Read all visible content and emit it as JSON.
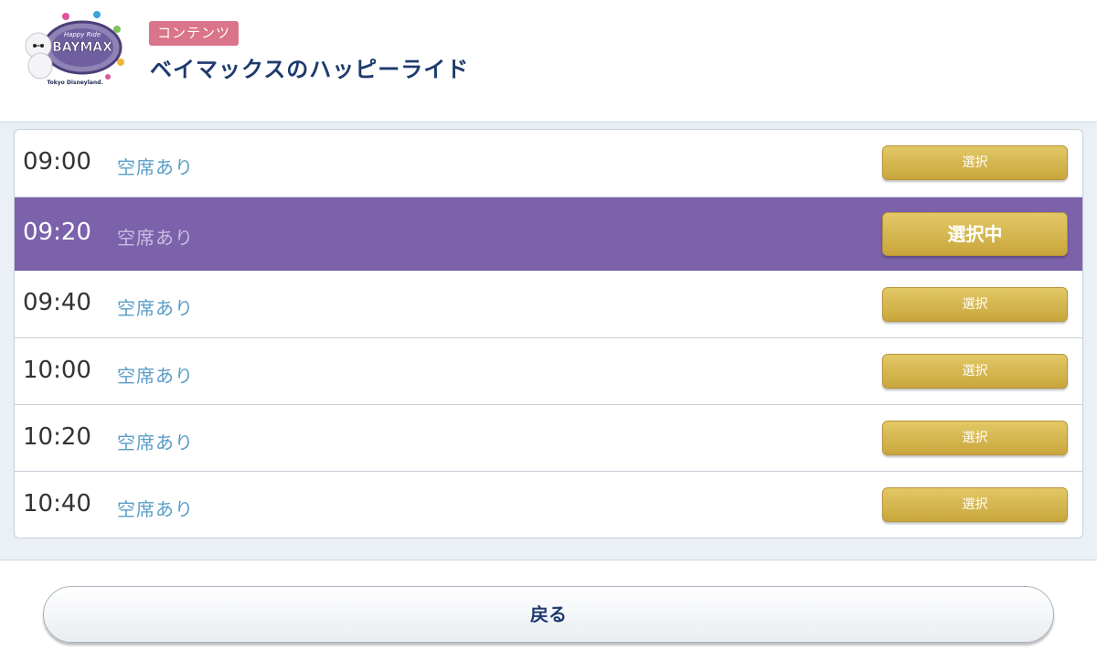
{
  "header": {
    "badge": "コンテンツ",
    "title": "ベイマックスのハッピーライド",
    "logo": {
      "line1": "Happy Ride",
      "line2": "BAYMAX",
      "line3": "Tokyo Disneyland."
    }
  },
  "slots": [
    {
      "time": "09:00",
      "status": "空席あり",
      "button": "選択"
    },
    {
      "time": "09:20",
      "status": "空席あり",
      "button": "選択中",
      "selected": true
    },
    {
      "time": "09:40",
      "status": "空席あり",
      "button": "選択"
    },
    {
      "time": "10:00",
      "status": "空席あり",
      "button": "選択"
    },
    {
      "time": "10:20",
      "status": "空席あり",
      "button": "選択"
    },
    {
      "time": "10:40",
      "status": "空席あり",
      "button": "選択"
    }
  ],
  "footer": {
    "back_label": "戻る"
  },
  "colors": {
    "badge": "#d9748a",
    "title": "#1e3a6e",
    "selected_row": "#7b62ab",
    "button_gold": "#d4b24c",
    "status_text": "#5a9ec7"
  }
}
